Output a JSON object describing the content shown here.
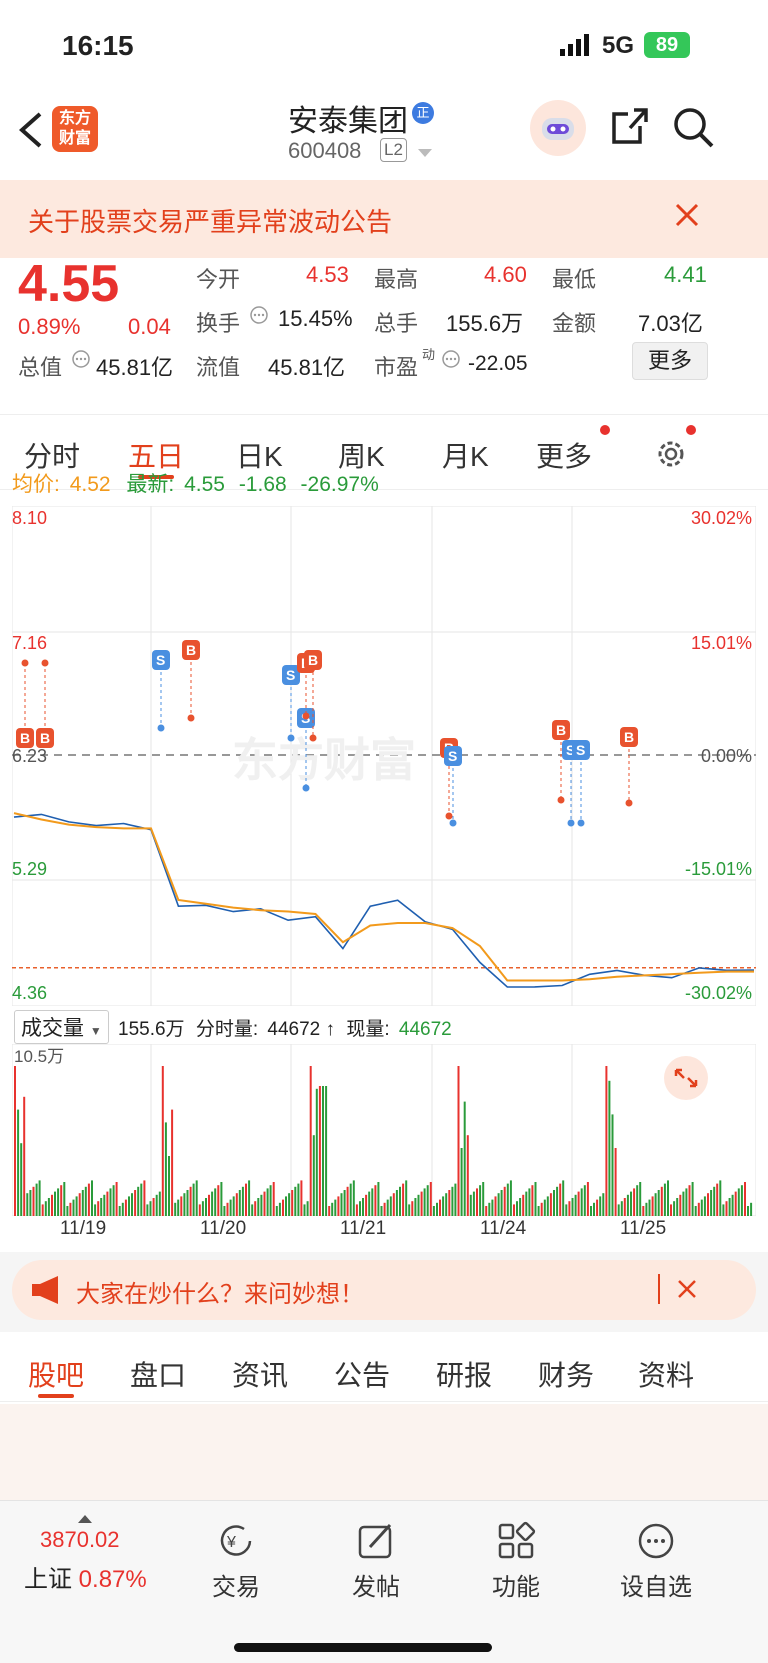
{
  "status_bar": {
    "time": "16:15",
    "network": "5G",
    "battery": "89"
  },
  "header": {
    "title": "安泰集团",
    "title_badge": "正",
    "code": "600408",
    "level": "L2",
    "logo_text": "东方财富"
  },
  "notice": {
    "text": "关于股票交易严重异常波动公告"
  },
  "quote": {
    "price": "4.55",
    "change_pct": "0.89%",
    "change": "0.04",
    "open_label": "今开",
    "open": "4.53",
    "high_label": "最高",
    "high": "4.60",
    "low_label": "最低",
    "low": "4.41",
    "turnover_label": "换手",
    "turnover": "15.45%",
    "volume_label": "总手",
    "volume": "155.6万",
    "amount_label": "金额",
    "amount": "7.03亿",
    "mktcap_label": "总值",
    "mktcap": "45.81亿",
    "float_label": "流值",
    "float": "45.81亿",
    "pe_label": "市盈",
    "pe_sup": "动",
    "pe": "-22.05",
    "more_label": "更多"
  },
  "tabs": [
    "分时",
    "五日",
    "日K",
    "周K",
    "月K",
    "更多"
  ],
  "chart_info": {
    "avg_label": "均价:",
    "avg": "4.52",
    "latest_label": "最新:",
    "latest": "4.55",
    "latest_change": "-1.68",
    "latest_pct": "-26.97%",
    "watermark": "东方财富"
  },
  "volume_info": {
    "selector": "成交量",
    "total": "155.6万",
    "period_label": "分时量:",
    "period": "44672 ↑",
    "now_label": "现量:",
    "now": "44672",
    "max_label": "10.5万"
  },
  "promo": {
    "text": "大家在炒什么？来问妙想！"
  },
  "subtabs": [
    "股吧",
    "盘口",
    "资讯",
    "公告",
    "研报",
    "财务",
    "资料"
  ],
  "bottom_nav": {
    "index_value": "3870.02",
    "index_name": "上证",
    "index_pct": "0.87%",
    "items": [
      "交易",
      "发帖",
      "功能",
      "设自选"
    ]
  },
  "colors": {
    "up": "#e8322e",
    "down": "#2a9b3a",
    "accent": "#e2401c",
    "avg_line": "#f29a1c",
    "price_line": "#1f5fb0"
  },
  "chart_data": {
    "type": "line",
    "x_labels": [
      "11/19",
      "11/20",
      "11/21",
      "11/24",
      "11/25"
    ],
    "y_left_ticks": [
      "8.10",
      "7.16",
      "6.23",
      "5.29",
      "4.36"
    ],
    "y_right_ticks": [
      "30.02%",
      "15.01%",
      "0.00%",
      "-15.01%",
      "-30.02%"
    ],
    "prev_close": 6.23,
    "ylim": [
      4.36,
      8.1
    ],
    "current_price": 4.55,
    "series": [
      {
        "name": "最新",
        "values": [
          5.7,
          5.74,
          5.7,
          5.69,
          5.66,
          5.63,
          5.05,
          5.01,
          4.98,
          5.02,
          4.95,
          4.93,
          4.7,
          5.05,
          5.05,
          4.9,
          4.86,
          4.62,
          4.38,
          4.4,
          4.43,
          4.47,
          4.52,
          4.5,
          4.5,
          4.53,
          4.53,
          4.55
        ]
      },
      {
        "name": "均价",
        "values": [
          5.76,
          5.71,
          5.67,
          5.65,
          5.64,
          5.64,
          5.08,
          5.05,
          5.02,
          5.0,
          4.99,
          4.97,
          4.75,
          4.88,
          4.9,
          4.9,
          4.86,
          4.72,
          4.45,
          4.45,
          4.45,
          4.46,
          4.48,
          4.49,
          4.5,
          4.51,
          4.52,
          4.52
        ]
      }
    ],
    "markers": [
      "B",
      "B",
      "S",
      "B",
      "S",
      "S",
      "B",
      "B",
      "B",
      "S",
      "B",
      "S",
      "S",
      "B"
    ],
    "volume": {
      "max": "10.5万"
    }
  }
}
